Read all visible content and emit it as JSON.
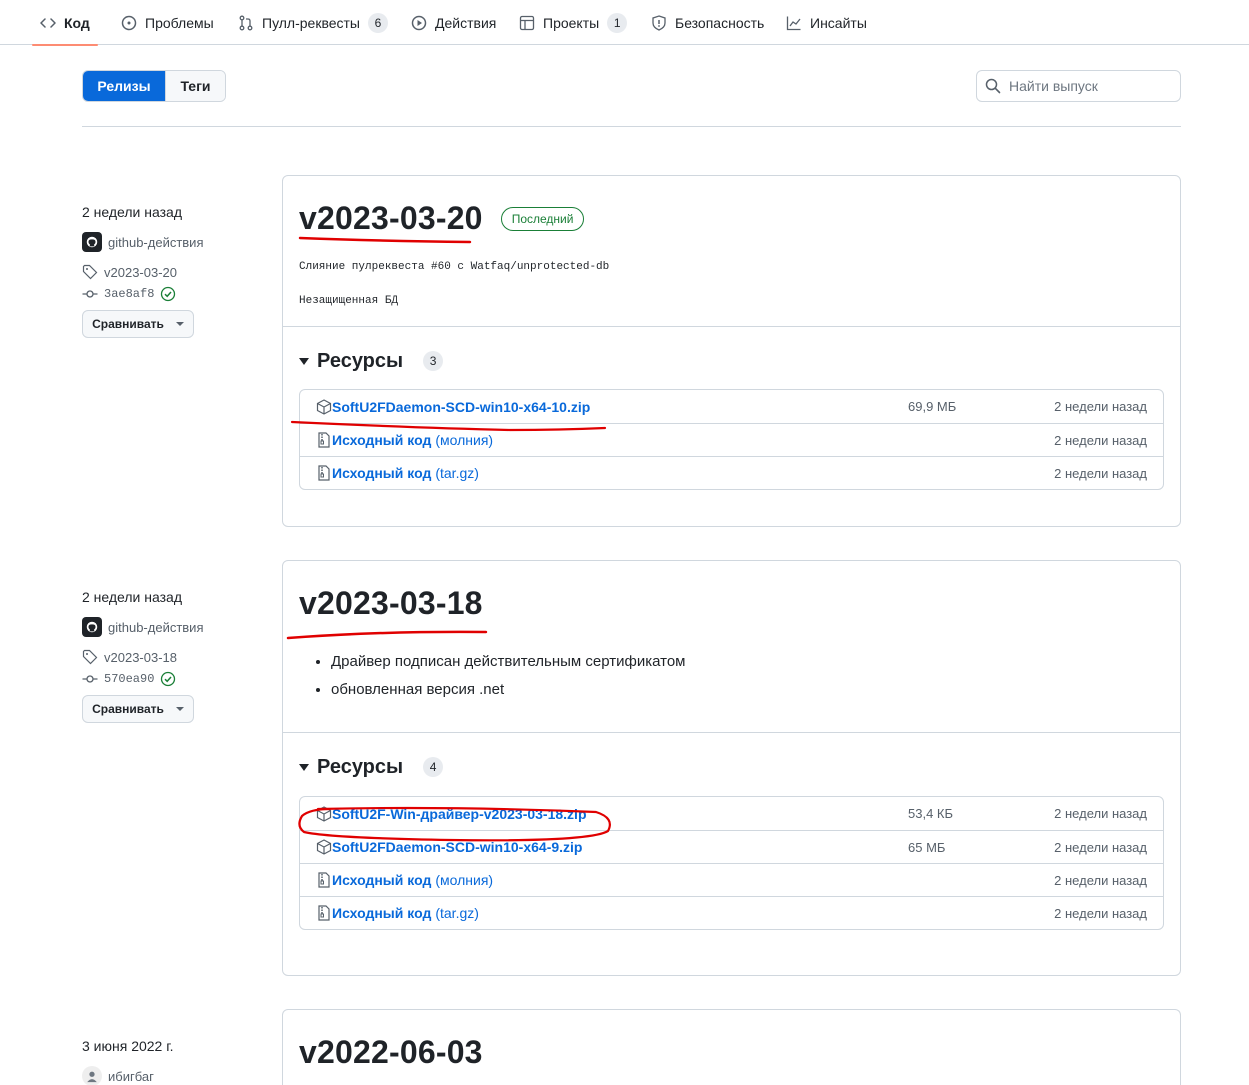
{
  "nav": {
    "items": [
      {
        "label": "Код",
        "icon": "code-icon",
        "active": true
      },
      {
        "label": "Проблемы",
        "icon": "issue-opened-icon"
      },
      {
        "label": "Пулл-реквесты",
        "icon": "git-pull-request-icon",
        "count": "6"
      },
      {
        "label": "Действия",
        "icon": "play-icon"
      },
      {
        "label": "Проекты",
        "icon": "table-icon",
        "count": "1"
      },
      {
        "label": "Безопасность",
        "icon": "shield-icon"
      },
      {
        "label": "Инсайты",
        "icon": "graph-icon"
      }
    ]
  },
  "toolbar": {
    "releases_label": "Релизы",
    "tags_label": "Теги",
    "search_placeholder": "Найти выпуск"
  },
  "releases": [
    {
      "date": "2 недели назад",
      "author": "github-действия",
      "tag": "v2023-03-20",
      "commit": "3ae8af8",
      "compare_label": "Сравнивать",
      "title": "v2023-03-20",
      "latest_label": "Последний",
      "notes_mono": [
        "Слияние пулреквеста #60 с Watfaq/unprotected-db",
        "Незащищенная БД"
      ],
      "assets_label": "Ресурсы",
      "assets_count": "3",
      "assets": [
        {
          "name": "SoftU2FDaemon-SCD-win10-x64-10.zip",
          "size": "69,9 МБ",
          "date": "2 недели назад"
        },
        {
          "name": "Исходный код",
          "suffix": "(молния)",
          "date": "2 недели назад"
        },
        {
          "name": "Исходный код",
          "suffix": "(tar.gz)",
          "date": "2 недели назад"
        }
      ]
    },
    {
      "date": "2 недели назад",
      "author": "github-действия",
      "tag": "v2023-03-18",
      "commit": "570ea90",
      "compare_label": "Сравнивать",
      "title": "v2023-03-18",
      "notes": [
        "Драйвер подписан действительным сертификатом",
        "обновленная версия .net"
      ],
      "assets_label": "Ресурсы",
      "assets_count": "4",
      "assets": [
        {
          "name": "SoftU2F-Win-драйвер-v2023-03-18.zip",
          "size": "53,4 КБ",
          "date": "2 недели назад"
        },
        {
          "name": "SoftU2FDaemon-SCD-win10-x64-9.zip",
          "size": "65 МБ",
          "date": "2 недели назад"
        },
        {
          "name": "Исходный код",
          "suffix": "(молния)",
          "date": "2 недели назад"
        },
        {
          "name": "Исходный код",
          "suffix": "(tar.gz)",
          "date": "2 недели назад"
        }
      ]
    },
    {
      "date": "3 июня 2022 г.",
      "author": "ибигбаг",
      "title": "v2022-06-03"
    }
  ],
  "colors": {
    "accent": "#0969da",
    "latest": "#1a7f37",
    "nav_underline": "#fd8c73",
    "annotation": "#e00000"
  }
}
